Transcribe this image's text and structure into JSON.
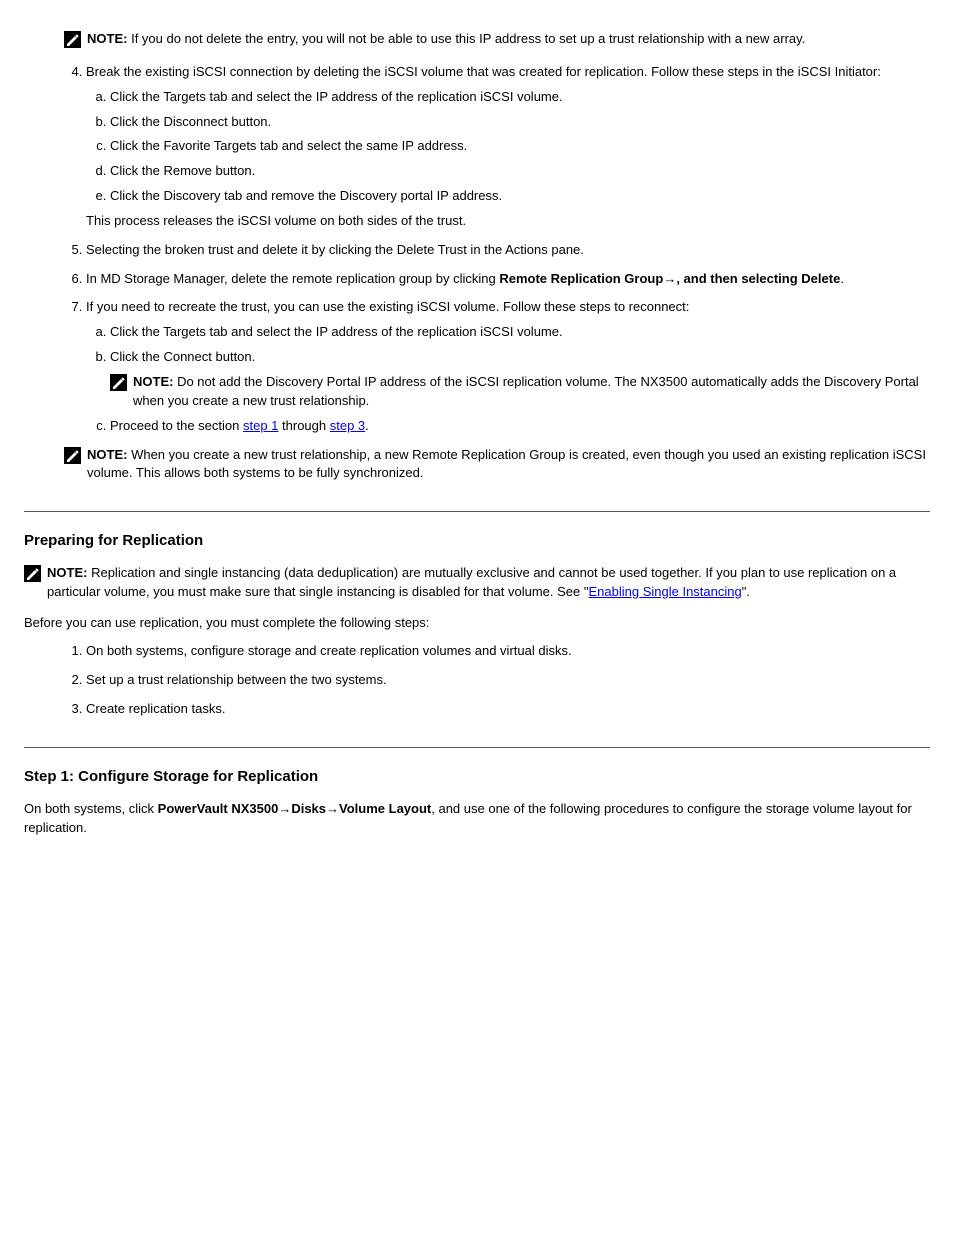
{
  "note1": {
    "label": "NOTE:",
    "text": "If you do not delete the entry, you will not be able to use this IP address to set up a trust relationship with a new array."
  },
  "steps_a": {
    "s4": {
      "text_a": "Break the existing iSCSI connection by deleting the iSCSI volume that was created for replication. Follow these steps in the iSCSI Initiator:",
      "a": "Click the Targets tab and select the IP address of the replication iSCSI volume.",
      "b": "Click the Disconnect button.",
      "c": "Click the Favorite Targets tab and select the same IP address.",
      "d": "Click the Remove button.",
      "e": "Click the Discovery tab and remove the Discovery portal IP address.",
      "text_b": "This process releases the iSCSI volume on both sides of the trust."
    },
    "s5": "Selecting the broken trust and delete it by clicking the Delete Trust in the Actions pane.",
    "s6_a": "In MD Storage Manager, delete the remote replication group by clicking ",
    "s6_b": "Remote Replication Group",
    "s6_c": ", and then selecting ",
    "s6_d": "Delete",
    "s6_e": ".",
    "s7": "If you need to recreate the trust, you can use the existing iSCSI volume. Follow these steps to reconnect:",
    "s7a": "Click the Targets tab and select the IP address of the replication iSCSI volume.",
    "s7b": "Click the Connect button.",
    "s7b_note_label": "NOTE:",
    "s7b_note_text": "Do not add the Discovery Portal IP address of the iSCSI replication volume. The NX3500 automatically adds the Discovery Portal when you create a new trust relationship.",
    "s7c_a": "Proceed to the section ",
    "s7c_link1": "step 1",
    "s7c_mid": " through ",
    "s7c_link2": "step 3",
    "s7c_b": "."
  },
  "note2": {
    "label": "NOTE:",
    "text": "When you create a new trust relationship, a new Remote Replication Group is created, even though you used an existing replication iSCSI volume. This allows both systems to be fully synchronized."
  },
  "heading1": "Preparing for Replication",
  "note3": {
    "label": "NOTE:",
    "text_a": "Replication and single instancing (data deduplication) are mutually exclusive and cannot be used together. If you plan to use replication on a particular volume, you must make sure that single instancing is disabled for that volume. See \"",
    "text_link": "Enabling Single Instancing",
    "text_b": "\"."
  },
  "prep_intro": "Before you can use replication, you must complete the following steps:",
  "prep": {
    "s1": "On both systems, configure storage and create replication volumes and virtual disks.",
    "s2": "Set up a trust relationship between the two systems.",
    "s3": "Create replication tasks."
  },
  "heading2": "Step 1: Configure Storage for Replication",
  "step1_intro_a": "On both systems, click ",
  "step1_intro_b": "PowerVault NX3500",
  "step1_intro_c": "Disks",
  "step1_intro_d": "Volume Layout",
  "step1_intro_e": ", and use one of the following procedures to configure the storage volume layout for replication.",
  "arrow": "→"
}
